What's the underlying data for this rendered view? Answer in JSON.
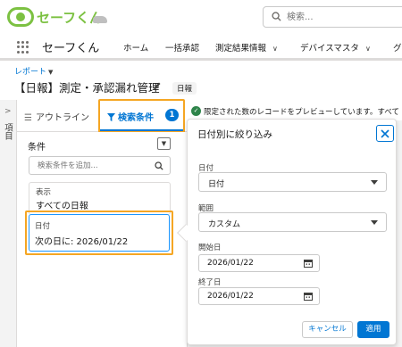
{
  "brand": {
    "logo_text": "セーフくん"
  },
  "search": {
    "placeholder": "検索..."
  },
  "nav": {
    "app_name": "セーフくん",
    "items": [
      {
        "label": "ホーム"
      },
      {
        "label": "一括承認"
      },
      {
        "label": "測定結果情報"
      },
      {
        "label": "デバイスマスタ"
      },
      {
        "label": "グ"
      }
    ]
  },
  "header": {
    "breadcrumb": "レポート",
    "title": "【日報】測定・承認漏れ管理",
    "badge": "日報"
  },
  "rail": {
    "label": "項目"
  },
  "tabs": {
    "outline": "アウトライン",
    "filters": "検索条件",
    "filters_count": "1"
  },
  "filters_panel": {
    "conditions_label": "条件",
    "search_placeholder": "検索条件を追加...",
    "show": {
      "caption": "表示",
      "value": "すべての日報"
    },
    "date": {
      "caption": "日付",
      "value": "次の日に: 2026/01/22"
    }
  },
  "preview": {
    "text": "限定された数のレコードをプレビューしています。すべて"
  },
  "popover": {
    "title": "日付別に絞り込み",
    "field_label": "日付",
    "field_value": "日付",
    "range_label": "範囲",
    "range_value": "カスタム",
    "start_label": "開始日",
    "start_value": "2026/01/22",
    "end_label": "終了日",
    "end_value": "2026/01/22",
    "cancel": "キャンセル",
    "apply": "適用"
  },
  "colors": {
    "brand_green": "#7cc142",
    "accent_blue": "#0176d3",
    "highlight_orange": "#f5a623",
    "success_green": "#2e844a"
  },
  "icons": [
    "search-icon",
    "waffle-icon",
    "pencil-icon",
    "funnel-icon",
    "check-icon",
    "close-icon",
    "calendar-icon",
    "chevron-down-icon"
  ]
}
